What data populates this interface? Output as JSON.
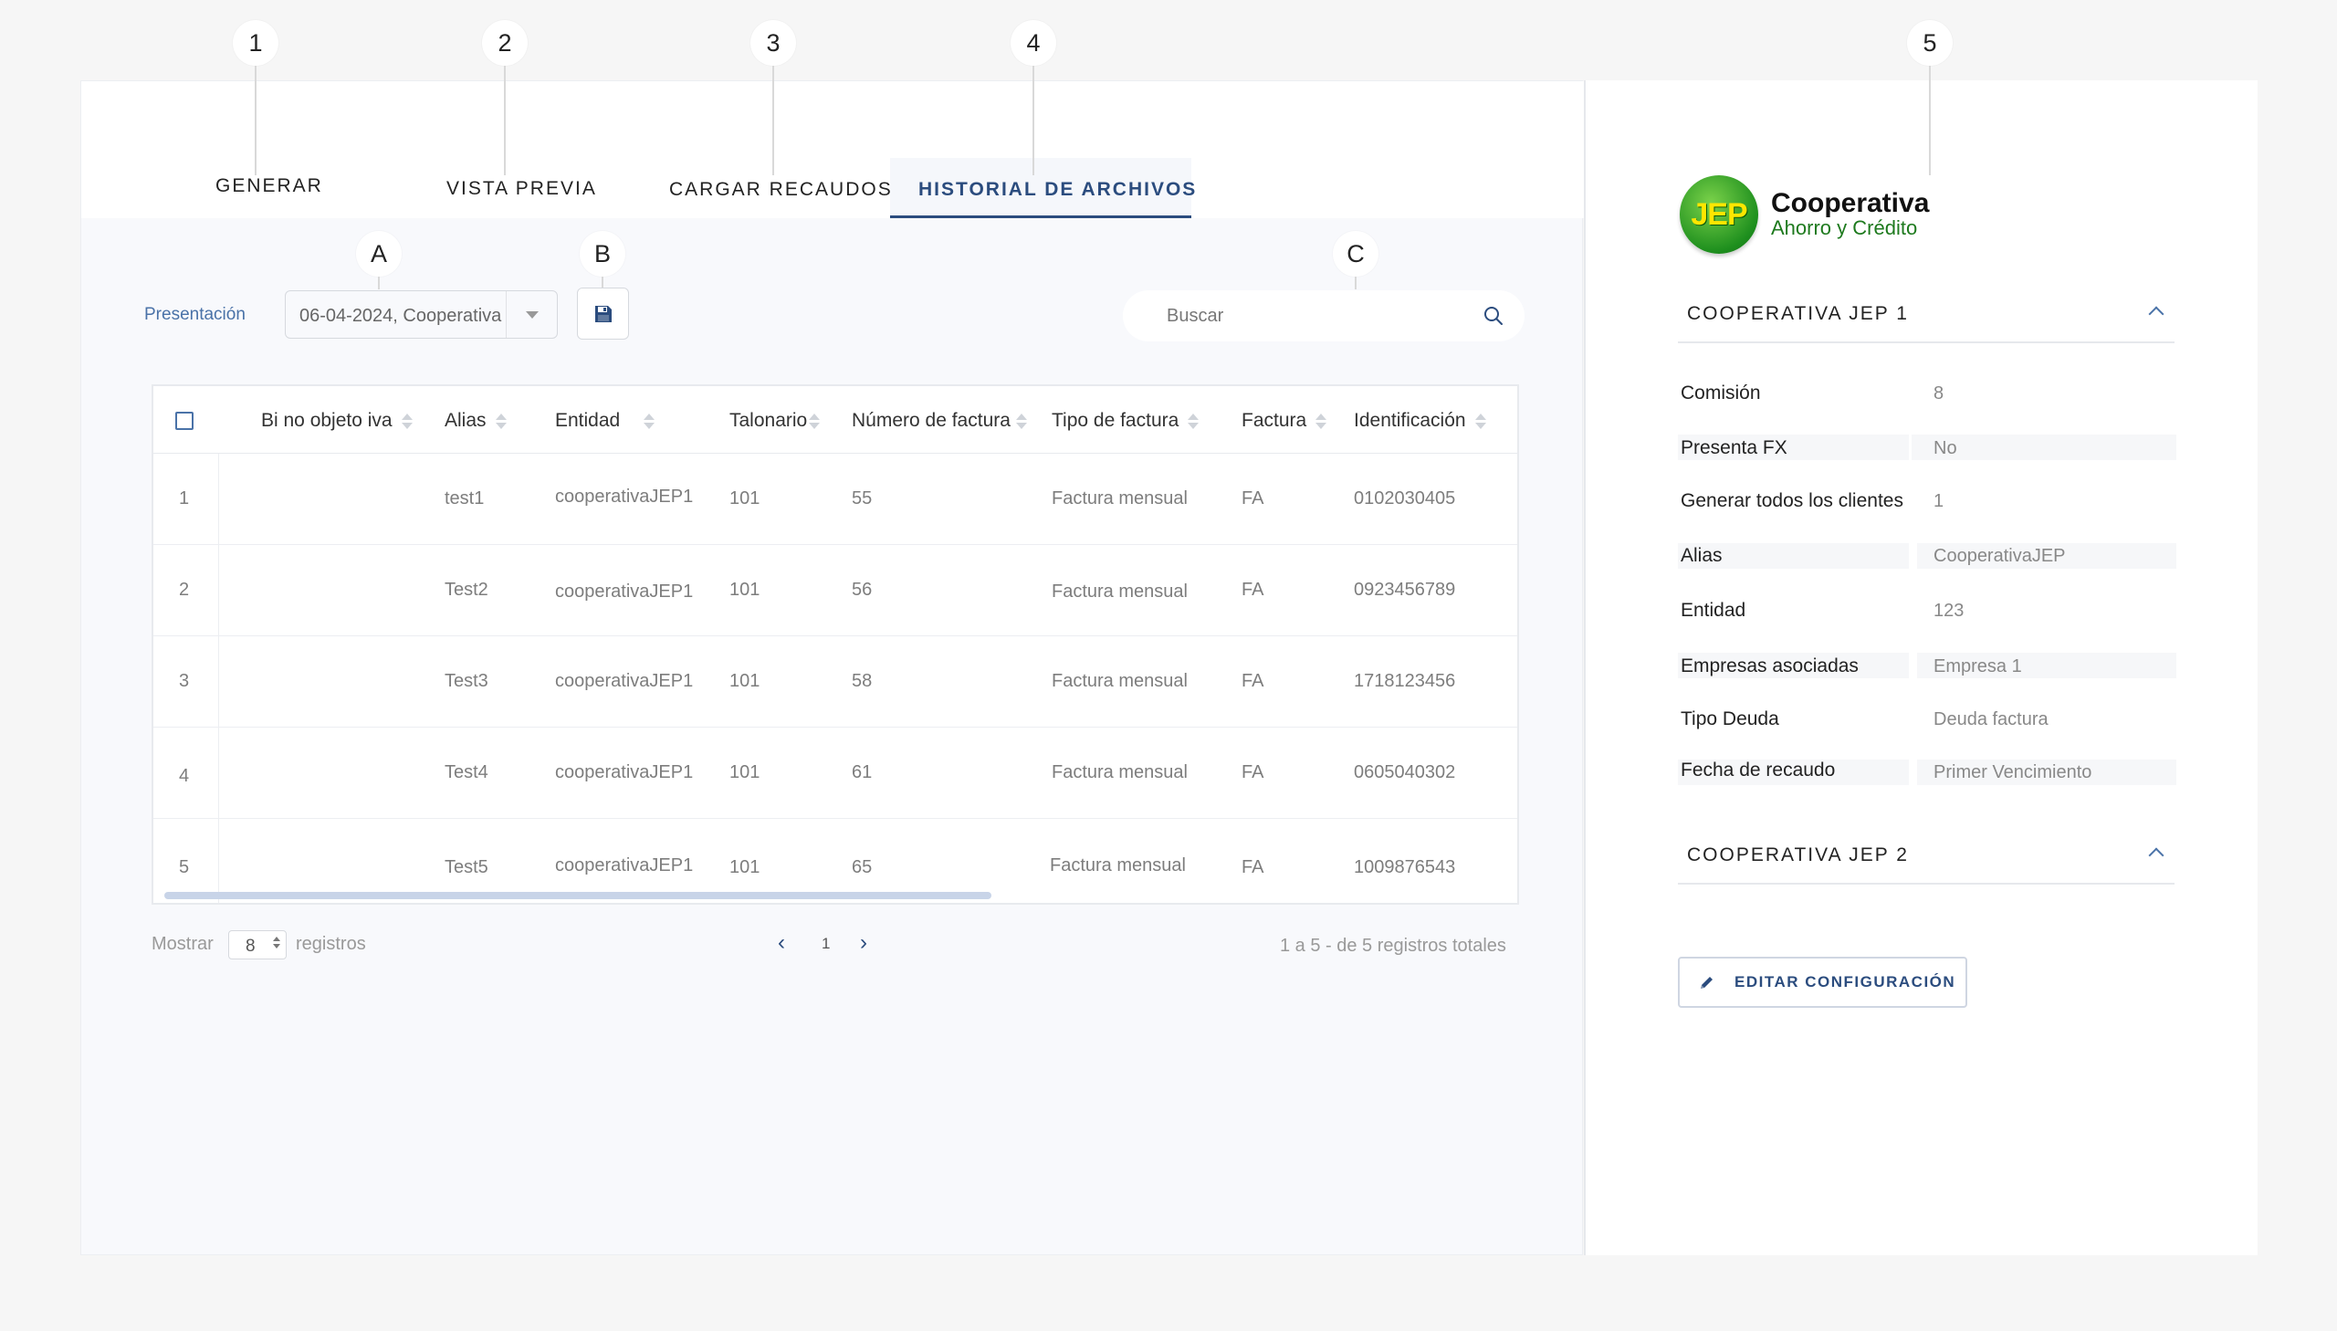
{
  "callouts": {
    "c1": "1",
    "c2": "2",
    "c3": "3",
    "c4": "4",
    "c5": "5",
    "ca": "A",
    "cb": "B",
    "cc": "C"
  },
  "tabs": {
    "generar": "GENERAR",
    "vista_previa": "VISTA PREVIA",
    "cargar_recaudos": "CARGAR RECAUDOS",
    "historial": "HISTORIAL DE ARCHIVOS",
    "active": "historial"
  },
  "toolbar": {
    "presentacion_label": "Presentación",
    "presentacion_value": "06-04-2024, Cooperativa",
    "save_icon": "floppy-disk-icon",
    "search_placeholder": "Buscar"
  },
  "table": {
    "columns": [
      "Bi no objeto iva",
      "Alias",
      "Entidad",
      "Talonario",
      "Número de factura",
      "Tipo de factura",
      "Factura",
      "Identificación"
    ],
    "rows": [
      {
        "n": "1",
        "alias": "test1",
        "entidad": "cooperativaJEP1",
        "talonario": "101",
        "numero": "55",
        "tipo": "Factura mensual",
        "factura": "FA",
        "id": "0102030405"
      },
      {
        "n": "2",
        "alias": "Test2",
        "entidad": "cooperativaJEP1",
        "talonario": "101",
        "numero": "56",
        "tipo": "Factura mensual",
        "factura": "FA",
        "id": "0923456789"
      },
      {
        "n": "3",
        "alias": "Test3",
        "entidad": "cooperativaJEP1",
        "talonario": "101",
        "numero": "58",
        "tipo": "Factura mensual",
        "factura": "FA",
        "id": "1718123456"
      },
      {
        "n": "4",
        "alias": "Test4",
        "entidad": "cooperativaJEP1",
        "talonario": "101",
        "numero": "61",
        "tipo": "Factura mensual",
        "factura": "FA",
        "id": "0605040302"
      },
      {
        "n": "5",
        "alias": "Test5",
        "entidad": "cooperativaJEP1",
        "talonario": "101",
        "numero": "65",
        "tipo": "Factura mensual",
        "factura": "FA",
        "id": "1009876543"
      }
    ]
  },
  "pagination": {
    "show_label": "Mostrar",
    "page_size": "8",
    "records_label": "registros",
    "current_page": "1",
    "summary": "1 a 5 - de 5 registros totales"
  },
  "side": {
    "logo_line1": "Cooperativa",
    "logo_line2": "Ahorro y Crédito",
    "logo_mark": "JEP",
    "section1_title": "COOPERATIVA JEP 1",
    "section2_title": "COOPERATIVA JEP 2",
    "fields": [
      {
        "label": "Comisión",
        "value": "8"
      },
      {
        "label": "Presenta FX",
        "value": "No"
      },
      {
        "label": "Generar todos los clientes",
        "value": "1"
      },
      {
        "label": "Alias",
        "value": "CooperativaJEP"
      },
      {
        "label": "Entidad",
        "value": "123"
      },
      {
        "label": "Empresas asociadas",
        "value": "Empresa 1"
      },
      {
        "label": "Tipo Deuda",
        "value": "Deuda factura"
      },
      {
        "label": "Fecha de recaudo",
        "value": "Primer Vencimiento"
      }
    ],
    "edit_button": "EDITAR CONFIGURACIÓN"
  },
  "colors": {
    "accent": "#2b4c7e",
    "label_blue": "#4a72a8",
    "logo_green": "#1e8f1e",
    "logo_yellow": "#ffe600"
  }
}
